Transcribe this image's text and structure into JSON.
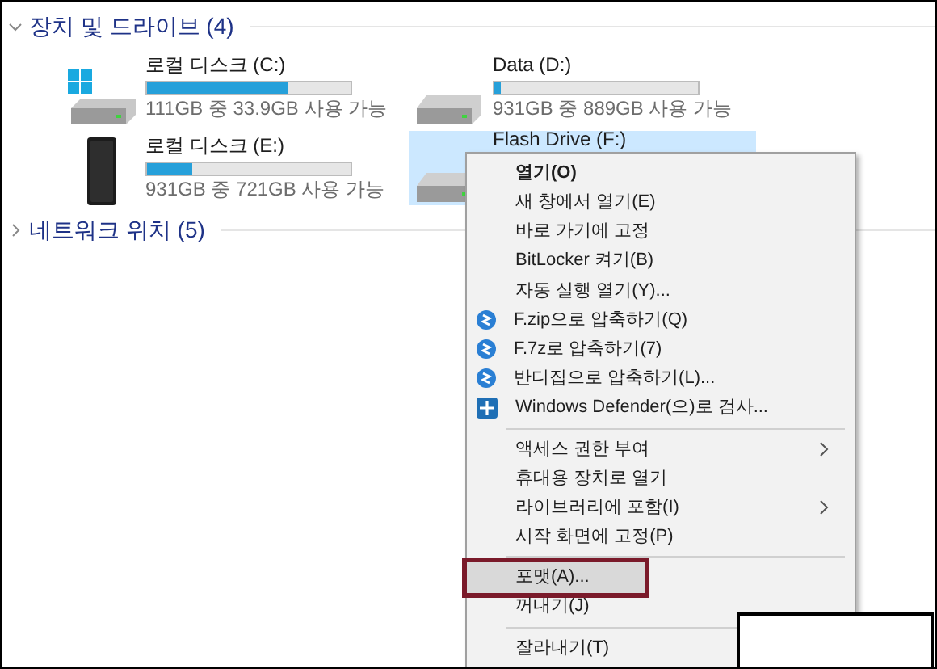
{
  "groups": [
    {
      "title": "장치 및 드라이브 (4)",
      "expanded": true
    },
    {
      "title": "네트워크 위치 (5)",
      "expanded": false
    }
  ],
  "drives": [
    {
      "name": "로컬 디스크 (C:)",
      "kind": "system",
      "level": 0.69,
      "space": "111GB 중 33.9GB 사용 가능",
      "selected": false
    },
    {
      "name": "Data (D:)",
      "kind": "drive",
      "level": 0.03,
      "space": "931GB 중 889GB 사용 가능",
      "selected": false
    },
    {
      "name": "로컬 디스크 (E:)",
      "kind": "external",
      "level": 0.22,
      "space": "931GB 중 721GB 사용 가능",
      "selected": false
    },
    {
      "name": "Flash Drive (F:)",
      "kind": "drive",
      "selected": true
    }
  ],
  "context_menu": [
    {
      "kind": "item",
      "label": "열기(O)",
      "bold": true
    },
    {
      "kind": "item",
      "label": "새 창에서 열기(E)"
    },
    {
      "kind": "item",
      "label": "바로 가기에 고정"
    },
    {
      "kind": "item",
      "label": "BitLocker 켜기(B)"
    },
    {
      "kind": "item",
      "label": "자동 실행 열기(Y)..."
    },
    {
      "kind": "compress",
      "label": "F.zip으로 압축하기(Q)"
    },
    {
      "kind": "compress",
      "label": "F.7z로 압축하기(7)"
    },
    {
      "kind": "compress",
      "label": "반디집으로 압축하기(L)..."
    },
    {
      "kind": "scan",
      "label": "Windows Defender(으)로 검사..."
    },
    {
      "kind": "separator"
    },
    {
      "kind": "item",
      "label": "액세스 권한 부여",
      "submenu": true
    },
    {
      "kind": "item",
      "label": "휴대용 장치로 열기"
    },
    {
      "kind": "item",
      "label": "라이브러리에 포함(I)",
      "submenu": true
    },
    {
      "kind": "item",
      "label": "시작 화면에 고정(P)"
    },
    {
      "kind": "separator"
    },
    {
      "kind": "item",
      "label": "포맷(A)...",
      "hovered": true,
      "highlighted": true
    },
    {
      "kind": "item",
      "label": "꺼내기(J)"
    },
    {
      "kind": "separator"
    },
    {
      "kind": "item",
      "label": "잘라내기(T)"
    }
  ]
}
